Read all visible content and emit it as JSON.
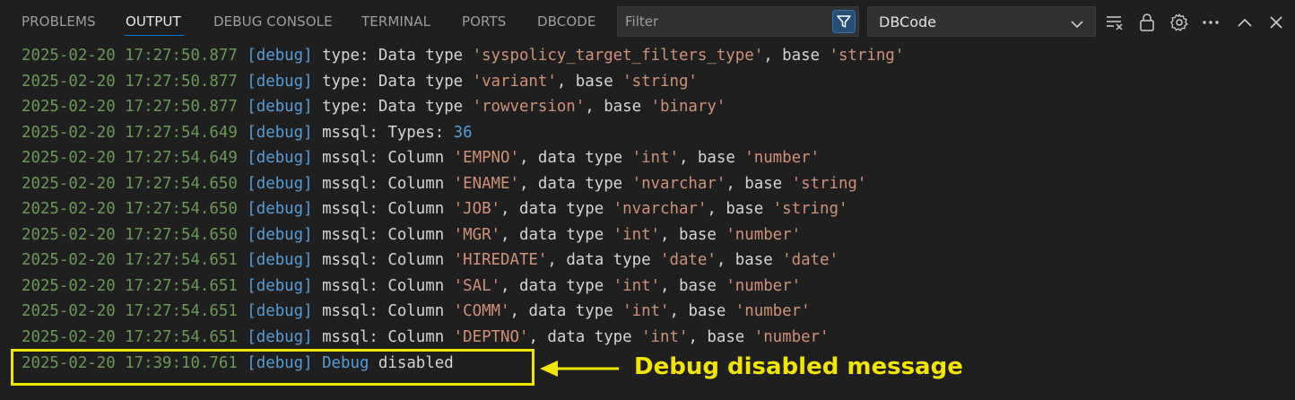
{
  "tabs": [
    {
      "label": "PROBLEMS"
    },
    {
      "label": "OUTPUT"
    },
    {
      "label": "DEBUG CONSOLE"
    },
    {
      "label": "TERMINAL"
    },
    {
      "label": "PORTS"
    },
    {
      "label": "DBCODE"
    }
  ],
  "active_tab": "OUTPUT",
  "filter": {
    "placeholder": "Filter",
    "value": ""
  },
  "channel": {
    "selected": "DBCode"
  },
  "toolbar_icons": [
    "filter-icon",
    "clear-output-icon",
    "lock-icon",
    "settings-gear-icon",
    "more-actions-icon",
    "maximize-panel-icon",
    "close-panel-icon"
  ],
  "colors": {
    "timestamp": "#6a9955",
    "level": "#569cd6",
    "string": "#ce9178",
    "number": "#569cd6",
    "annotation": "#f2e500"
  },
  "log": {
    "lines": [
      {
        "ts": "2025-02-20 17:27:50.877",
        "level": "[debug]",
        "p1": "type: Data type ",
        "s1": "'syspolicy_target_filters_type'",
        "p2": ", base ",
        "s2": "'string'"
      },
      {
        "ts": "2025-02-20 17:27:50.877",
        "level": "[debug]",
        "p1": "type: Data type ",
        "s1": "'variant'",
        "p2": ", base ",
        "s2": "'string'"
      },
      {
        "ts": "2025-02-20 17:27:50.877",
        "level": "[debug]",
        "p1": "type: Data type ",
        "s1": "'rowversion'",
        "p2": ", base ",
        "s2": "'binary'"
      },
      {
        "ts": "2025-02-20 17:27:54.649",
        "level": "[debug]",
        "p1": "mssql: Types: ",
        "n1": "36"
      },
      {
        "ts": "2025-02-20 17:27:54.649",
        "level": "[debug]",
        "p1": "mssql: Column ",
        "s1": "'EMPNO'",
        "p2": ", data type ",
        "s2": "'int'",
        "p3": ", base ",
        "s3": "'number'"
      },
      {
        "ts": "2025-02-20 17:27:54.650",
        "level": "[debug]",
        "p1": "mssql: Column ",
        "s1": "'ENAME'",
        "p2": ", data type ",
        "s2": "'nvarchar'",
        "p3": ", base ",
        "s3": "'string'"
      },
      {
        "ts": "2025-02-20 17:27:54.650",
        "level": "[debug]",
        "p1": "mssql: Column ",
        "s1": "'JOB'",
        "p2": ", data type ",
        "s2": "'nvarchar'",
        "p3": ", base ",
        "s3": "'string'"
      },
      {
        "ts": "2025-02-20 17:27:54.650",
        "level": "[debug]",
        "p1": "mssql: Column ",
        "s1": "'MGR'",
        "p2": ", data type ",
        "s2": "'int'",
        "p3": ", base ",
        "s3": "'number'"
      },
      {
        "ts": "2025-02-20 17:27:54.651",
        "level": "[debug]",
        "p1": "mssql: Column ",
        "s1": "'HIREDATE'",
        "p2": ", data type ",
        "s2": "'date'",
        "p3": ", base ",
        "s3": "'date'"
      },
      {
        "ts": "2025-02-20 17:27:54.651",
        "level": "[debug]",
        "p1": "mssql: Column ",
        "s1": "'SAL'",
        "p2": ", data type ",
        "s2": "'int'",
        "p3": ", base ",
        "s3": "'number'"
      },
      {
        "ts": "2025-02-20 17:27:54.651",
        "level": "[debug]",
        "p1": "mssql: Column ",
        "s1": "'COMM'",
        "p2": ", data type ",
        "s2": "'int'",
        "p3": ", base ",
        "s3": "'number'"
      },
      {
        "ts": "2025-02-20 17:27:54.651",
        "level": "[debug]",
        "p1": "mssql: Column ",
        "s1": "'DEPTNO'",
        "p2": ", data type ",
        "s2": "'int'",
        "p3": ", base ",
        "s3": "'number'"
      },
      {
        "ts": "2025-02-20 17:39:10.761",
        "level": "[debug]",
        "kw": "Debug",
        "p1": " disabled"
      }
    ]
  },
  "annotation": {
    "text": "Debug disabled message"
  }
}
